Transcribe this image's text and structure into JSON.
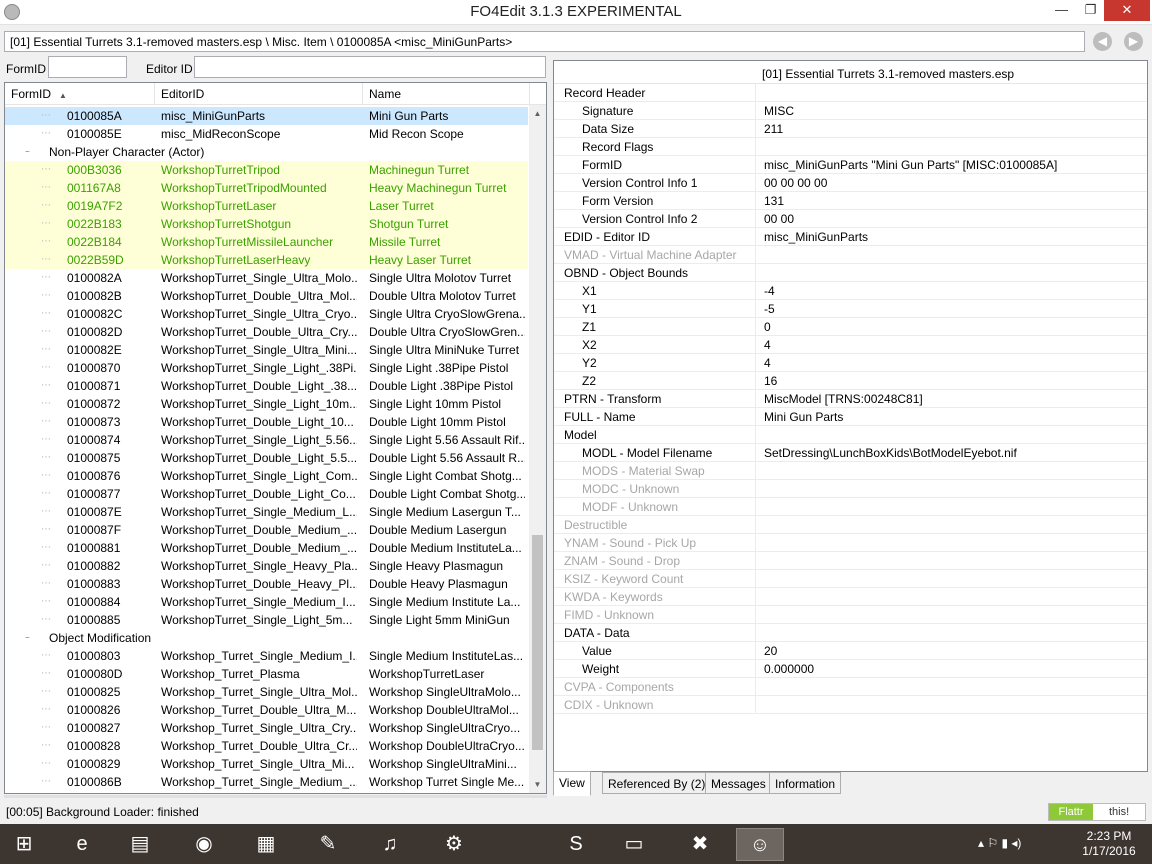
{
  "window": {
    "title": "FO4Edit 3.1.3 EXPERIMENTAL",
    "min": "—",
    "max": "❐",
    "close": "✕"
  },
  "path": "[01] Essential Turrets 3.1-removed masters.esp \\ Misc. Item \\ 0100085A <misc_MiniGunParts>",
  "filters": {
    "formid_label": "FormID",
    "editorid_label": "Editor ID",
    "formid_value": "",
    "editorid_value": ""
  },
  "tree": {
    "headers": {
      "formid": "FormID",
      "editorid": "EditorID",
      "name": "Name"
    },
    "rows": [
      {
        "formid": "0100085A",
        "editorid": "misc_MiniGunParts",
        "name": "Mini Gun Parts",
        "state": "sel"
      },
      {
        "formid": "0100085E",
        "editorid": "misc_MidReconScope",
        "name": "Mid Recon Scope",
        "state": ""
      },
      {
        "cat": "Non-Player Character (Actor)"
      },
      {
        "formid": "000B3036",
        "editorid": "WorkshopTurretTripod",
        "name": "Machinegun Turret",
        "state": "hl"
      },
      {
        "formid": "001167A8",
        "editorid": "WorkshopTurretTripodMounted",
        "name": "Heavy Machinegun Turret",
        "state": "hl"
      },
      {
        "formid": "0019A7F2",
        "editorid": "WorkshopTurretLaser",
        "name": "Laser Turret",
        "state": "hl"
      },
      {
        "formid": "0022B183",
        "editorid": "WorkshopTurretShotgun",
        "name": "Shotgun Turret",
        "state": "hl"
      },
      {
        "formid": "0022B184",
        "editorid": "WorkshopTurretMissileLauncher",
        "name": "Missile Turret",
        "state": "hl"
      },
      {
        "formid": "0022B59D",
        "editorid": "WorkshopTurretLaserHeavy",
        "name": "Heavy Laser Turret",
        "state": "hl"
      },
      {
        "formid": "0100082A",
        "editorid": "WorkshopTurret_Single_Ultra_Molo...",
        "name": "Single Ultra Molotov Turret",
        "state": ""
      },
      {
        "formid": "0100082B",
        "editorid": "WorkshopTurret_Double_Ultra_Mol...",
        "name": "Double Ultra Molotov Turret",
        "state": ""
      },
      {
        "formid": "0100082C",
        "editorid": "WorkshopTurret_Single_Ultra_Cryo...",
        "name": "Single Ultra CryoSlowGrena...",
        "state": ""
      },
      {
        "formid": "0100082D",
        "editorid": "WorkshopTurret_Double_Ultra_Cry...",
        "name": "Double Ultra CryoSlowGren...",
        "state": ""
      },
      {
        "formid": "0100082E",
        "editorid": "WorkshopTurret_Single_Ultra_Mini...",
        "name": "Single Ultra MiniNuke Turret",
        "state": ""
      },
      {
        "formid": "01000870",
        "editorid": "WorkshopTurret_Single_Light_.38Pi...",
        "name": "Single Light .38Pipe Pistol",
        "state": ""
      },
      {
        "formid": "01000871",
        "editorid": "WorkshopTurret_Double_Light_.38...",
        "name": "Double Light .38Pipe Pistol",
        "state": ""
      },
      {
        "formid": "01000872",
        "editorid": "WorkshopTurret_Single_Light_10m...",
        "name": "Single Light 10mm Pistol",
        "state": ""
      },
      {
        "formid": "01000873",
        "editorid": "WorkshopTurret_Double_Light_10...",
        "name": "Double Light 10mm Pistol",
        "state": ""
      },
      {
        "formid": "01000874",
        "editorid": "WorkshopTurret_Single_Light_5.56...",
        "name": "Single Light 5.56 Assault Rif...",
        "state": ""
      },
      {
        "formid": "01000875",
        "editorid": "WorkshopTurret_Double_Light_5.5...",
        "name": "Double Light 5.56 Assault R...",
        "state": ""
      },
      {
        "formid": "01000876",
        "editorid": "WorkshopTurret_Single_Light_Com...",
        "name": "Single Light Combat Shotg...",
        "state": ""
      },
      {
        "formid": "01000877",
        "editorid": "WorkshopTurret_Double_Light_Co...",
        "name": "Double Light Combat Shotg...",
        "state": ""
      },
      {
        "formid": "0100087E",
        "editorid": "WorkshopTurret_Single_Medium_L...",
        "name": "Single Medium Lasergun T...",
        "state": ""
      },
      {
        "formid": "0100087F",
        "editorid": "WorkshopTurret_Double_Medium_...",
        "name": "Double Medium Lasergun",
        "state": ""
      },
      {
        "formid": "01000881",
        "editorid": "WorkshopTurret_Double_Medium_...",
        "name": "Double Medium InstituteLa...",
        "state": ""
      },
      {
        "formid": "01000882",
        "editorid": "WorkshopTurret_Single_Heavy_Pla...",
        "name": "Single Heavy Plasmagun",
        "state": ""
      },
      {
        "formid": "01000883",
        "editorid": "WorkshopTurret_Double_Heavy_Pl...",
        "name": "Double Heavy Plasmagun",
        "state": ""
      },
      {
        "formid": "01000884",
        "editorid": "WorkshopTurret_Single_Medium_I...",
        "name": "Single Medium Institute La...",
        "state": ""
      },
      {
        "formid": "01000885",
        "editorid": "WorkshopTurret_Single_Light_5m...",
        "name": "Single Light 5mm MiniGun",
        "state": ""
      },
      {
        "cat": "Object Modification"
      },
      {
        "formid": "01000803",
        "editorid": "Workshop_Turret_Single_Medium_I...",
        "name": "Single Medium InstituteLas...",
        "state": ""
      },
      {
        "formid": "0100080D",
        "editorid": "Workshop_Turret_Plasma",
        "name": "WorkshopTurretLaser",
        "state": ""
      },
      {
        "formid": "01000825",
        "editorid": "Workshop_Turret_Single_Ultra_Mol...",
        "name": "Workshop SingleUltraMolo...",
        "state": ""
      },
      {
        "formid": "01000826",
        "editorid": "Workshop_Turret_Double_Ultra_M...",
        "name": "Workshop DoubleUltraMol...",
        "state": ""
      },
      {
        "formid": "01000827",
        "editorid": "Workshop_Turret_Single_Ultra_Cry...",
        "name": "Workshop SingleUltraCryo...",
        "state": ""
      },
      {
        "formid": "01000828",
        "editorid": "Workshop_Turret_Double_Ultra_Cr...",
        "name": "Workshop DoubleUltraCryo...",
        "state": ""
      },
      {
        "formid": "01000829",
        "editorid": "Workshop_Turret_Single_Ultra_Mi...",
        "name": "Workshop SingleUltraMini...",
        "state": ""
      },
      {
        "formid": "0100086B",
        "editorid": "Workshop_Turret_Single_Medium_...",
        "name": "Workshop Turret Single Me...",
        "state": ""
      }
    ]
  },
  "record": {
    "header": "[01] Essential Turrets 3.1-removed masters.esp",
    "rows": [
      {
        "k": "Record Header",
        "v": "",
        "sub": false,
        "grey": false
      },
      {
        "k": "Signature",
        "v": "MISC",
        "sub": true,
        "grey": false
      },
      {
        "k": "Data Size",
        "v": "211",
        "sub": true,
        "grey": false
      },
      {
        "k": "Record Flags",
        "v": "",
        "sub": true,
        "grey": false
      },
      {
        "k": "FormID",
        "v": "misc_MiniGunParts \"Mini Gun Parts\" [MISC:0100085A]",
        "sub": true,
        "grey": false
      },
      {
        "k": "Version Control Info 1",
        "v": "00 00 00 00",
        "sub": true,
        "grey": false
      },
      {
        "k": "Form Version",
        "v": "131",
        "sub": true,
        "grey": false
      },
      {
        "k": "Version Control Info 2",
        "v": "00 00",
        "sub": true,
        "grey": false
      },
      {
        "k": "EDID - Editor ID",
        "v": "misc_MiniGunParts",
        "sub": false,
        "grey": false
      },
      {
        "k": "VMAD - Virtual Machine Adapter",
        "v": "",
        "sub": false,
        "grey": true
      },
      {
        "k": "OBND - Object Bounds",
        "v": "",
        "sub": false,
        "grey": false
      },
      {
        "k": "X1",
        "v": "-4",
        "sub": true,
        "grey": false
      },
      {
        "k": "Y1",
        "v": "-5",
        "sub": true,
        "grey": false
      },
      {
        "k": "Z1",
        "v": "0",
        "sub": true,
        "grey": false
      },
      {
        "k": "X2",
        "v": "4",
        "sub": true,
        "grey": false
      },
      {
        "k": "Y2",
        "v": "4",
        "sub": true,
        "grey": false
      },
      {
        "k": "Z2",
        "v": "16",
        "sub": true,
        "grey": false
      },
      {
        "k": "PTRN - Transform",
        "v": "MiscModel [TRNS:00248C81]",
        "sub": false,
        "grey": false
      },
      {
        "k": "FULL - Name",
        "v": "Mini Gun Parts",
        "sub": false,
        "grey": false
      },
      {
        "k": "Model",
        "v": "",
        "sub": false,
        "grey": false
      },
      {
        "k": "MODL - Model Filename",
        "v": "SetDressing\\LunchBoxKids\\BotModelEyebot.nif",
        "sub": true,
        "grey": false
      },
      {
        "k": "MODS - Material Swap",
        "v": "",
        "sub": true,
        "grey": true
      },
      {
        "k": "MODC - Unknown",
        "v": "",
        "sub": true,
        "grey": true
      },
      {
        "k": "MODF - Unknown",
        "v": "",
        "sub": true,
        "grey": true
      },
      {
        "k": "Destructible",
        "v": "",
        "sub": false,
        "grey": true
      },
      {
        "k": "YNAM - Sound - Pick Up",
        "v": "",
        "sub": false,
        "grey": true
      },
      {
        "k": "ZNAM - Sound - Drop",
        "v": "",
        "sub": false,
        "grey": true
      },
      {
        "k": "KSIZ - Keyword Count",
        "v": "",
        "sub": false,
        "grey": true
      },
      {
        "k": "KWDA - Keywords",
        "v": "",
        "sub": false,
        "grey": true
      },
      {
        "k": "FIMD - Unknown",
        "v": "",
        "sub": false,
        "grey": true
      },
      {
        "k": "DATA - Data",
        "v": "",
        "sub": false,
        "grey": false
      },
      {
        "k": "Value",
        "v": "20",
        "sub": true,
        "grey": false
      },
      {
        "k": "Weight",
        "v": "0.000000",
        "sub": true,
        "grey": false
      },
      {
        "k": "CVPA - Components",
        "v": "",
        "sub": false,
        "grey": true
      },
      {
        "k": "CDIX - Unknown",
        "v": "",
        "sub": false,
        "grey": true
      }
    ]
  },
  "tabs": [
    {
      "label": "View",
      "active": true
    },
    {
      "label": "Referenced By (2)",
      "active": false
    },
    {
      "label": "Messages",
      "active": false
    },
    {
      "label": "Information",
      "active": false
    }
  ],
  "status": {
    "text": "[00:05] Background Loader: finished",
    "flattr_left": "Flattr",
    "flattr_right": "this!"
  },
  "taskbar": {
    "icons": [
      {
        "name": "windows-start-icon",
        "glyph": "⊞"
      },
      {
        "name": "internet-explorer-icon",
        "glyph": "e"
      },
      {
        "name": "file-explorer-icon",
        "glyph": "▤"
      },
      {
        "name": "chrome-icon",
        "glyph": "◉"
      },
      {
        "name": "store-icon",
        "glyph": "▦"
      },
      {
        "name": "paint-icon",
        "glyph": "✎"
      },
      {
        "name": "itunes-icon",
        "glyph": "♫"
      },
      {
        "name": "steam-icon",
        "glyph": "⚙"
      },
      {
        "name": "skype-icon",
        "glyph": "S"
      },
      {
        "name": "notepad-icon",
        "glyph": "▭"
      },
      {
        "name": "xedit-icon",
        "glyph": "✖"
      },
      {
        "name": "fo4edit-icon",
        "glyph": "☺"
      }
    ],
    "tray": "▴ ⚐ ▮ ◂)",
    "time": "2:23 PM",
    "date": "1/17/2016"
  }
}
